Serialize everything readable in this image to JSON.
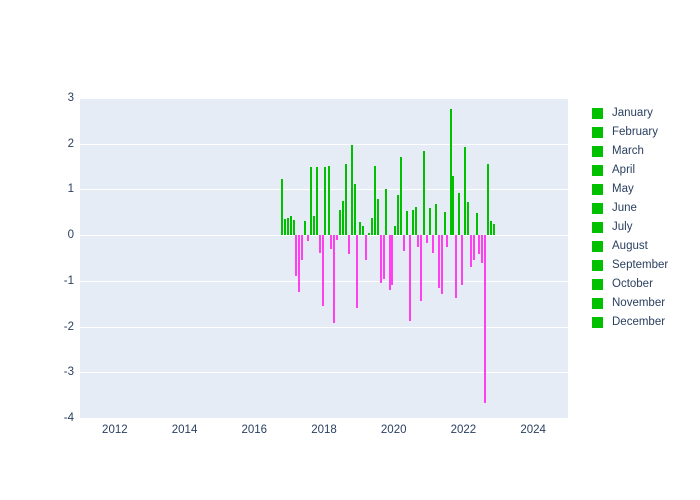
{
  "chart_data": {
    "type": "bar",
    "title": "",
    "xlabel": "",
    "ylabel": "",
    "xlim": [
      2011.0,
      2025.0
    ],
    "ylim": [
      -4,
      3
    ],
    "grid": true,
    "legend_position": "right",
    "colors": {
      "positive": "#00c000",
      "negative": "#ff40f0",
      "plot_background": "#e5ecf6",
      "paper_background": "#ffffff",
      "gridline": "#ffffff",
      "tick_text": "#2a3f5f"
    },
    "xticks": [
      "2012",
      "2014",
      "2016",
      "2018",
      "2020",
      "2022",
      "2024"
    ],
    "xtick_values": [
      2012,
      2014,
      2016,
      2018,
      2020,
      2022,
      2024
    ],
    "yticks": [
      "3",
      "2",
      "1",
      "0",
      "-1",
      "-2",
      "-3",
      "-4"
    ],
    "ytick_values": [
      3,
      2,
      1,
      0,
      -1,
      -2,
      -3,
      -4
    ],
    "legend_entries": [
      "January",
      "February",
      "March",
      "April",
      "May",
      "June",
      "July",
      "August",
      "September",
      "October",
      "November",
      "December"
    ],
    "x": [
      2016.79,
      2016.88,
      2016.96,
      2017.04,
      2017.13,
      2017.21,
      2017.29,
      2017.38,
      2017.46,
      2017.54,
      2017.63,
      2017.71,
      2017.79,
      2017.88,
      2017.96,
      2018.04,
      2018.13,
      2018.21,
      2018.29,
      2018.38,
      2018.46,
      2018.54,
      2018.63,
      2018.71,
      2018.79,
      2018.88,
      2018.96,
      2019.04,
      2019.13,
      2019.21,
      2019.29,
      2019.38,
      2019.46,
      2019.54,
      2019.63,
      2019.71,
      2019.79,
      2019.88,
      2019.96,
      2020.04,
      2020.13,
      2020.21,
      2020.29,
      2020.38,
      2020.46,
      2020.54,
      2020.63,
      2020.71,
      2020.79,
      2020.88,
      2020.96,
      2021.04,
      2021.13,
      2021.21,
      2021.29,
      2021.38,
      2021.46,
      2021.54,
      2021.63,
      2021.71,
      2021.79,
      2021.88,
      2021.96,
      2022.04,
      2022.13,
      2022.21,
      2022.29,
      2022.38,
      2022.46,
      2022.54,
      2022.63,
      2022.71,
      2022.79,
      2022.88
    ],
    "values": [
      1.22,
      0.35,
      0.38,
      0.42,
      0.33,
      -0.9,
      -1.25,
      -0.55,
      0.32,
      -0.12,
      1.48,
      0.42,
      1.5,
      -0.4,
      -1.55,
      1.48,
      1.52,
      -0.3,
      -1.92,
      -0.1,
      0.55,
      0.75,
      1.55,
      -0.42,
      1.97,
      1.12,
      -1.6,
      0.28,
      0.2,
      -0.55,
      0.05,
      0.38,
      1.52,
      0.8,
      -1.05,
      -0.95,
      1.0,
      -1.2,
      -1.1,
      0.2,
      0.88,
      1.7,
      -0.35,
      0.52,
      -1.88,
      0.55,
      0.62,
      -0.25,
      -1.45,
      1.85,
      -0.18,
      0.6,
      -0.38,
      0.68,
      -1.15,
      -1.28,
      0.5,
      -0.25,
      2.76,
      1.3,
      -1.38,
      0.92,
      -1.08,
      1.93,
      0.72,
      -0.7,
      -0.55,
      0.48,
      -0.42,
      -0.62,
      -3.67,
      1.55,
      0.3,
      0.25
    ]
  }
}
